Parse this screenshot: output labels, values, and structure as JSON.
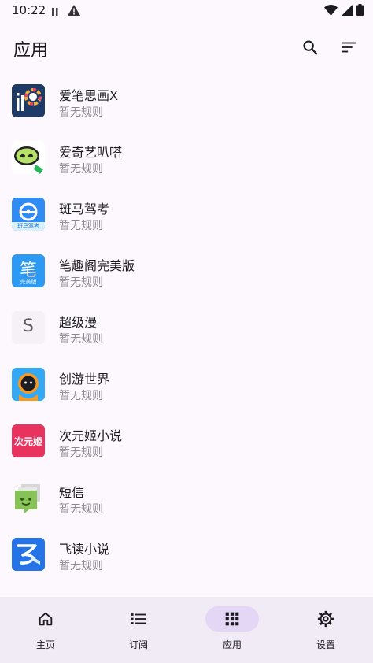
{
  "status": {
    "time": "10:22"
  },
  "header": {
    "title": "应用"
  },
  "apps": [
    {
      "name": "爱笔思画X",
      "sub": "暂无规则",
      "icon": "ibispaint-app-icon"
    },
    {
      "name": "爱奇艺叭嗒",
      "sub": "暂无规则",
      "icon": "iqiyi-bada-app-icon"
    },
    {
      "name": "斑马驾考",
      "sub": "暂无规则",
      "icon": "zebra-driving-app-icon",
      "icon_text": "斑马驾考"
    },
    {
      "name": "笔趣阁完美版",
      "sub": "暂无规则",
      "icon": "biquge-app-icon",
      "icon_text": "笔",
      "icon_subtext": "完美版"
    },
    {
      "name": "超级漫",
      "sub": "暂无规则",
      "icon": "letter-s-app-icon",
      "icon_text": "S"
    },
    {
      "name": "创游世界",
      "sub": "暂无规则",
      "icon": "chuangyou-app-icon"
    },
    {
      "name": "次元姬小说",
      "sub": "暂无规则",
      "icon": "ciyuanji-app-icon",
      "icon_text": "次元姬"
    },
    {
      "name": "短信",
      "sub": "暂无规则",
      "icon": "messaging-app-icon"
    },
    {
      "name": "飞读小说",
      "sub": "暂无规则",
      "icon": "feidu-app-icon"
    }
  ],
  "nav": [
    {
      "label": "主页",
      "icon": "home-icon"
    },
    {
      "label": "订阅",
      "icon": "list-icon"
    },
    {
      "label": "应用",
      "icon": "grid-icon",
      "active": true
    },
    {
      "label": "设置",
      "icon": "gear-icon"
    }
  ],
  "colors": {
    "background": "#fdf8fd",
    "nav_background": "#f1ebf5",
    "nav_active": "#e4d7f5",
    "subtext": "#8a8790"
  }
}
